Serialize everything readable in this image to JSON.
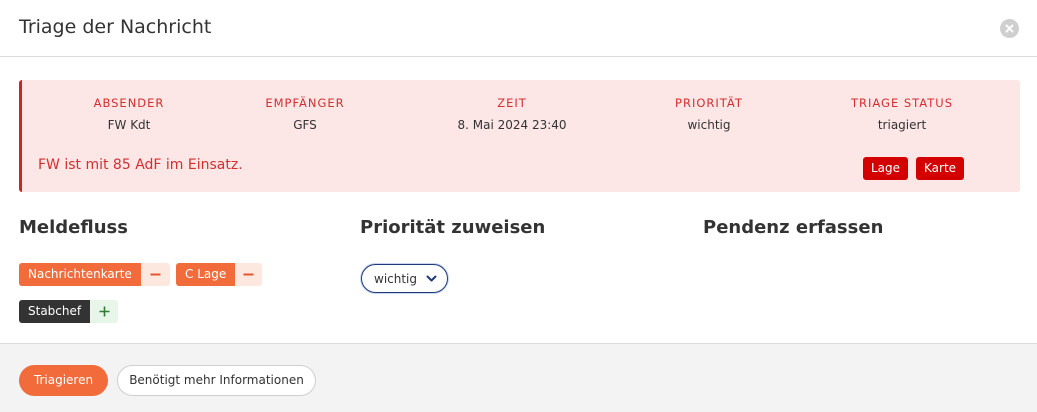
{
  "modal": {
    "title": "Triage der Nachricht",
    "close_icon": "close-icon"
  },
  "message": {
    "columns": [
      {
        "label": "Absender",
        "value": "FW Kdt"
      },
      {
        "label": "Empfänger",
        "value": "GFS"
      },
      {
        "label": "Zeit",
        "value": "8. Mai 2024 23:40"
      },
      {
        "label": "Priorität",
        "value": "wichtig"
      },
      {
        "label": "Triage Status",
        "value": "triagiert"
      }
    ],
    "text": "FW ist mit 85 AdF im Einsatz.",
    "buttons": {
      "lage": "Lage",
      "karte": "Karte"
    },
    "accent_color": "#d32f2f"
  },
  "sections": {
    "meldefluss": {
      "title": "Meldefluss",
      "tags": [
        {
          "label": "Nachrichtenkarte",
          "action": "remove"
        },
        {
          "label": "C Lage",
          "action": "remove"
        },
        {
          "label": "Stabchef",
          "action": "add"
        }
      ]
    },
    "prioritaet": {
      "title": "Priorität zuweisen",
      "selected": "wichtig"
    },
    "pendenz": {
      "title": "Pendenz erfassen"
    }
  },
  "footer": {
    "triagieren": "Triagieren",
    "mehr_info": "Benötigt mehr Informationen"
  },
  "colors": {
    "brand_orange": "#f26b3a",
    "danger_red": "#d40000",
    "dark": "#333333"
  }
}
